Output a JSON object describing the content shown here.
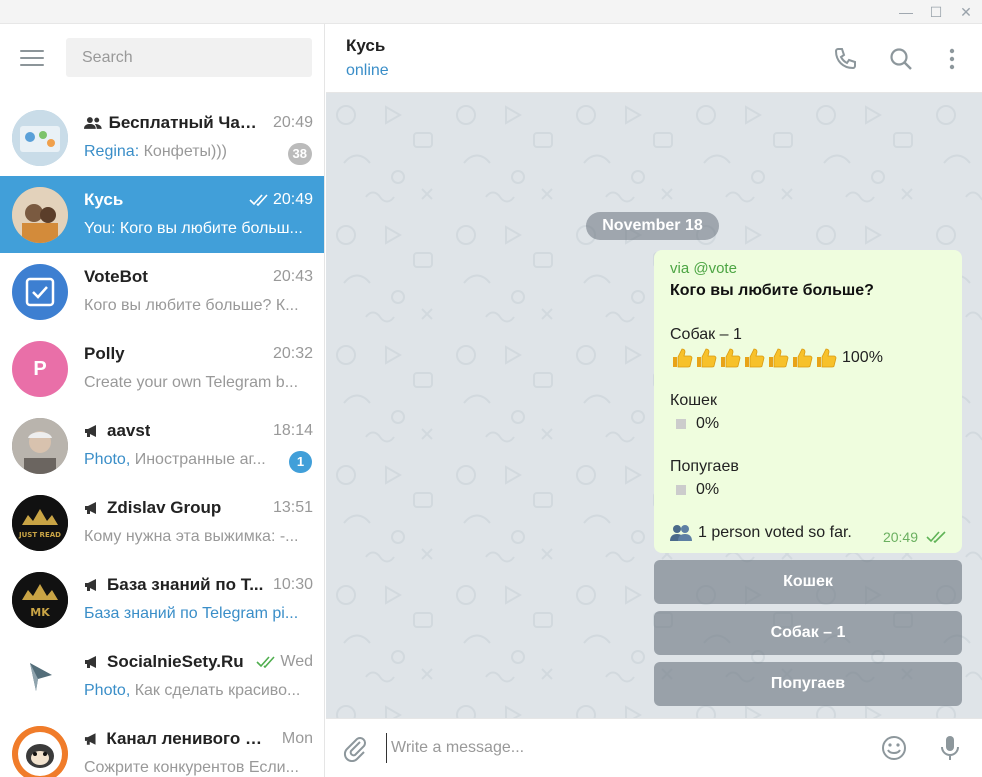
{
  "window": {
    "minimize_glyph": "—",
    "maximize_glyph": "☐",
    "close_glyph": "✕"
  },
  "sidebar": {
    "search_placeholder": "Search",
    "chats": [
      {
        "name": "Бесплатный Чат ...",
        "type": "group",
        "time": "20:49",
        "sender": "Regina:",
        "preview": " Конфеты)))",
        "badge": "38",
        "badge_color": "#bbbbbb",
        "avatar_color": "#a8c6d9",
        "avatar_icon": "photo"
      },
      {
        "name": "Кусь",
        "type": "private",
        "time": "20:49",
        "sender": "",
        "preview": "You: Кого вы любите больш...",
        "badge": "",
        "read": true,
        "active": true,
        "avatar_color": "#c9a27a",
        "avatar_icon": "photo"
      },
      {
        "name": "VoteBot",
        "type": "bot",
        "time": "20:43",
        "sender": "",
        "preview": "Кого вы любите больше?  К...",
        "badge": "",
        "avatar_color": "#3d7fd1",
        "avatar_icon": "checkbox-icon"
      },
      {
        "name": "Polly",
        "type": "bot",
        "time": "20:32",
        "sender": "",
        "preview": "Create your own Telegram b...",
        "badge": "",
        "avatar_color": "#e96fa8",
        "avatar_letter": "P"
      },
      {
        "name": "aavst",
        "type": "channel",
        "time": "18:14",
        "sender": "Photo,",
        "preview": " Иностранные аг...",
        "badge": "1",
        "badge_color": "#419fd9",
        "avatar_color": "#8f8f8f",
        "avatar_icon": "photo"
      },
      {
        "name": "Zdislav Group",
        "type": "channel",
        "time": "13:51",
        "sender": "",
        "preview": "Кому нужна эта выжимка: -...",
        "badge": "",
        "avatar_color": "#111111",
        "avatar_text": "JUST READ"
      },
      {
        "name": "База знаний по Т...",
        "type": "channel",
        "time": "10:30",
        "sender": "База знаний по Telegram pi...",
        "preview": "",
        "badge": "",
        "avatar_color": "#111111",
        "avatar_text": "MK"
      },
      {
        "name": "SocialnieSety.Ru",
        "type": "channel",
        "time": "Wed",
        "read": true,
        "sender": "Photo,",
        "preview": " Как сделать красиво...",
        "badge": "",
        "avatar_color": "#ffffff",
        "avatar_icon": "plane-logo"
      },
      {
        "name": "Канал ленивого S...",
        "type": "channel",
        "time": "Mon",
        "sender": "",
        "preview": "Сожрите конкурентов  Если...",
        "badge": "",
        "avatar_color": "#f07c2a",
        "avatar_icon": "sloth-logo"
      }
    ]
  },
  "header": {
    "title": "Кусь",
    "status": "online"
  },
  "messages": {
    "date": "November 18",
    "poll": {
      "via": "via @vote",
      "question": "Кого вы любите больше?",
      "options": [
        {
          "label": "Собак – 1",
          "thumbs": 7,
          "percent": "100%"
        },
        {
          "label": "Кошек",
          "thumbs": 0,
          "percent": "0%"
        },
        {
          "label": "Попугаев",
          "thumbs": 0,
          "percent": "0%"
        }
      ],
      "voted_text": "1 person voted so far.",
      "time": "20:49"
    },
    "buttons": [
      "Кошек",
      "Собак – 1",
      "Попугаев"
    ]
  },
  "composer": {
    "placeholder": "Write a message..."
  },
  "colors": {
    "accent": "#419fd9",
    "link": "#3a8ec8",
    "bubble": "#effdde",
    "chat_bg": "#dfe4e8"
  }
}
